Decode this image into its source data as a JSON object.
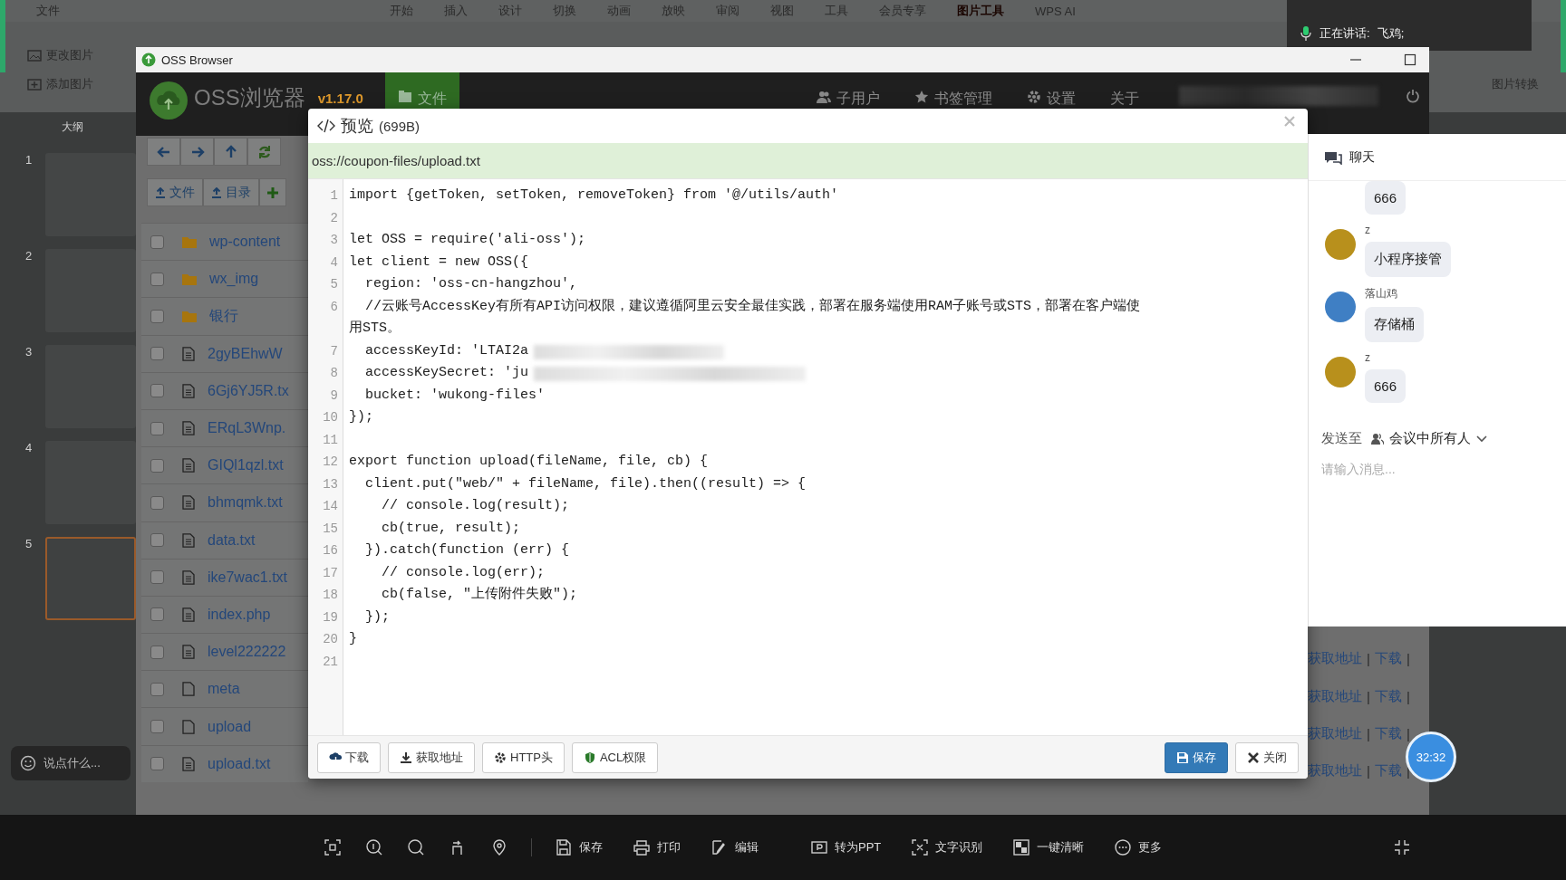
{
  "wps": {
    "menu": [
      "文件",
      "开始",
      "插入",
      "设计",
      "切换",
      "动画",
      "放映",
      "审阅",
      "视图",
      "工具",
      "会员专享",
      "图片工具",
      "WPS AI"
    ],
    "ribbon_left": [
      "更改图片",
      "添加图片"
    ],
    "ribbon_right": "图片转换",
    "outline_tab": "大纲",
    "slides": [
      {
        "number": "1",
        "selected": false
      },
      {
        "number": "2",
        "selected": false
      },
      {
        "number": "3",
        "selected": false
      },
      {
        "number": "4",
        "selected": false
      },
      {
        "number": "5",
        "selected": true
      }
    ],
    "comment_placeholder": "说点什么..."
  },
  "meeting": {
    "speaking_label": "正在讲话:",
    "speaker": "飞鸡;"
  },
  "oss_window": {
    "title": "OSS Browser",
    "app_name": "OSS浏览器",
    "version": "v1.17.0",
    "nav": [
      {
        "label": "文件",
        "selected": true
      },
      {
        "label": "子用户",
        "selected": false
      },
      {
        "label": "书签管理",
        "selected": false
      },
      {
        "label": "设置",
        "selected": false
      },
      {
        "label": "关于",
        "selected": false
      }
    ],
    "upload_buttons": [
      "文件",
      "目录"
    ],
    "files": [
      {
        "name": "wp-content",
        "kind": "folder",
        "checked": false
      },
      {
        "name": "wx_img",
        "kind": "folder",
        "checked": false
      },
      {
        "name": "银行",
        "kind": "folder",
        "checked": false
      },
      {
        "name": "2gyBEhwW",
        "kind": "text",
        "checked": false
      },
      {
        "name": "6Gj6YJ5R.tx",
        "kind": "text",
        "checked": false
      },
      {
        "name": "ERqL3Wnp.",
        "kind": "text",
        "checked": false
      },
      {
        "name": "GIQl1qzl.txt",
        "kind": "text",
        "checked": false
      },
      {
        "name": "bhmqmk.txt",
        "kind": "text",
        "checked": false
      },
      {
        "name": "data.txt",
        "kind": "text",
        "checked": false
      },
      {
        "name": "ike7wac1.txt",
        "kind": "text",
        "checked": false
      },
      {
        "name": "index.php",
        "kind": "text",
        "checked": false
      },
      {
        "name": "level222222",
        "kind": "text",
        "checked": false
      },
      {
        "name": "meta",
        "kind": "blank",
        "checked": false
      },
      {
        "name": "upload",
        "kind": "blank",
        "checked": false
      },
      {
        "name": "upload.txt",
        "kind": "text",
        "checked": false
      }
    ],
    "row_actions": [
      {
        "links": [
          "获取地址",
          "下载"
        ]
      },
      {
        "links": [
          "获取地址",
          "下载"
        ]
      },
      {
        "links": [
          "获取地址",
          "下载"
        ]
      },
      {
        "links": [
          "获取地址",
          "下载"
        ]
      }
    ],
    "separator": "|"
  },
  "preview": {
    "title": "预览",
    "size": "(699B)",
    "path": "oss://coupon-files/upload.txt",
    "code_lines": [
      {
        "number": "1",
        "text": "import {getToken, setToken, removeToken} from '@/utils/auth'"
      },
      {
        "number": "2"
      },
      {
        "number": "3",
        "text": "let OSS = require('ali-oss');"
      },
      {
        "number": "4",
        "text": "let client = new OSS({"
      },
      {
        "number": "5",
        "text": "  region: 'oss-cn-hangzhou',"
      },
      {
        "number": "6",
        "text": "  //云账号AccessKey有所有API访问权限，建议遵循阿里云安全最佳实践，部署在服务端使用RAM子账号或STS，部署在客户端使用STS。"
      },
      {
        "number": "7",
        "text": "  accessKeyId: 'LTAI2a",
        "redacted": true
      },
      {
        "number": "8",
        "text": "  accessKeySecret: 'ju",
        "redacted": true
      },
      {
        "number": "9",
        "text": "  bucket: 'wukong-files'"
      },
      {
        "number": "10",
        "text": "});"
      },
      {
        "number": "11"
      },
      {
        "number": "12",
        "text": "export function upload(fileName, file, cb) {"
      },
      {
        "number": "13",
        "text": "  client.put(\"web/\" + fileName, file).then((result) => {"
      },
      {
        "number": "14",
        "text": "    // console.log(result);"
      },
      {
        "number": "15",
        "text": "    cb(true, result);"
      },
      {
        "number": "16",
        "text": "  }).catch(function (err) {"
      },
      {
        "number": "17",
        "text": "    // console.log(err);"
      },
      {
        "number": "18",
        "text": "    cb(false, \"上传附件失败\");"
      },
      {
        "number": "19",
        "text": "  });"
      },
      {
        "number": "20",
        "text": "}"
      },
      {
        "number": "21"
      }
    ],
    "left_buttons": [
      {
        "label": "下载",
        "kind": "default"
      },
      {
        "label": "获取地址",
        "kind": "default"
      },
      {
        "label": "HTTP头",
        "kind": "default"
      },
      {
        "label": "ACL权限",
        "kind": "default"
      }
    ],
    "right_buttons": [
      {
        "label": "保存",
        "kind": "primary"
      },
      {
        "label": "关闭",
        "kind": "default"
      }
    ]
  },
  "chat": {
    "title": "聊天",
    "messages": [
      {
        "text": "666"
      },
      {
        "sender": "z",
        "text": "小程序接管",
        "color": "#b8901c"
      },
      {
        "sender": "落山鸡",
        "text": "存储桶",
        "color": "#3f7fc4"
      },
      {
        "sender": "z",
        "text": "666",
        "color": "#b8901c"
      }
    ],
    "send_to_label": "发送至",
    "send_to_target": "会议中所有人",
    "placeholder": "请输入消息..."
  },
  "viewer_toolbar": {
    "tools": [
      "保存",
      "打印",
      "编辑",
      "转为PPT",
      "文字识别",
      "一键清晰",
      "更多"
    ]
  },
  "timer": "32:32"
}
